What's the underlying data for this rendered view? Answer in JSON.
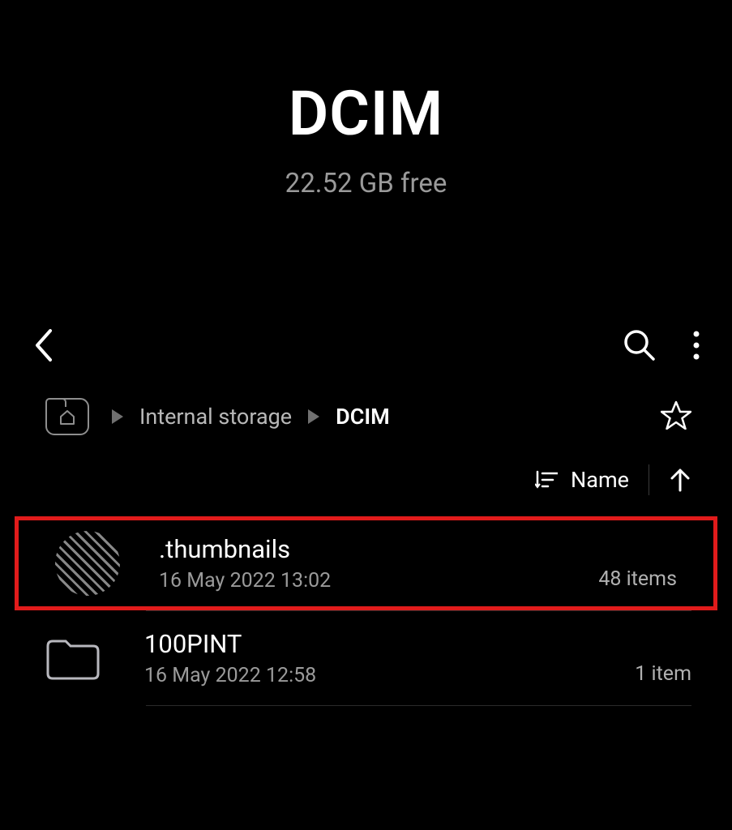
{
  "header": {
    "title": "DCIM",
    "subtitle": "22.52 GB free"
  },
  "breadcrumb": {
    "items": [
      {
        "label": "Internal storage",
        "current": false
      },
      {
        "label": "DCIM",
        "current": true
      }
    ]
  },
  "sort": {
    "label": "Name"
  },
  "files": [
    {
      "name": ".thumbnails",
      "date": "16 May 2022 13:02",
      "count": "48 items",
      "highlighted": true,
      "iconType": "hatched"
    },
    {
      "name": "100PINT",
      "date": "16 May 2022 12:58",
      "count": "1 item",
      "highlighted": false,
      "iconType": "folder"
    }
  ]
}
